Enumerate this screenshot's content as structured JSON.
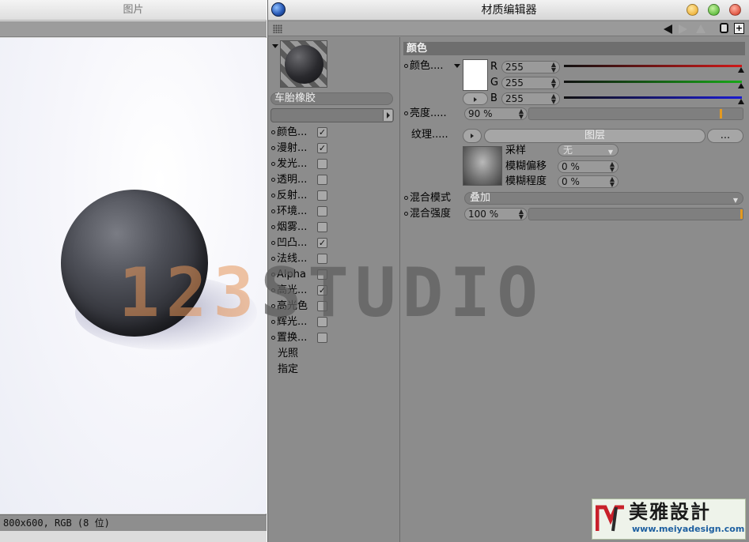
{
  "viewer": {
    "title": "图片",
    "status": "800x600, RGB (8 位)"
  },
  "editor": {
    "title": "材质编辑器",
    "material_name": "车胎橡胶",
    "channels": [
      {
        "label": "颜色...",
        "checked": true
      },
      {
        "label": "漫射...",
        "checked": true
      },
      {
        "label": "发光...",
        "checked": false
      },
      {
        "label": "透明...",
        "checked": false
      },
      {
        "label": "反射...",
        "checked": false
      },
      {
        "label": "环境...",
        "checked": false
      },
      {
        "label": "烟雾...",
        "checked": false
      },
      {
        "label": "凹凸...",
        "checked": true
      },
      {
        "label": "法线...",
        "checked": false
      },
      {
        "label": "Alpha",
        "checked": false
      },
      {
        "label": "高光...",
        "checked": true
      },
      {
        "label": "高光色",
        "checked": false
      },
      {
        "label": "辉光...",
        "checked": false
      },
      {
        "label": "置换...",
        "checked": false
      }
    ],
    "extra_items": [
      "光照",
      "指定"
    ],
    "section_title": "颜色",
    "color": {
      "label": "颜色....",
      "swatch": "#ffffff",
      "r_label": "R",
      "r_value": "255",
      "g_label": "G",
      "g_value": "255",
      "b_label": "B",
      "b_value": "255",
      "r_color": "#d01818",
      "g_color": "#18a818",
      "b_color": "#1a1ad0"
    },
    "brightness": {
      "label": "亮度.....",
      "value": "90 %",
      "level_percent": 90
    },
    "texture": {
      "label": "纹理.....",
      "layer_button": "图层",
      "more_button": "...",
      "sampling_label": "采样",
      "sampling_value": "无",
      "blur_offset_label": "模糊偏移",
      "blur_offset_value": "0 %",
      "blur_scale_label": "模糊程度",
      "blur_scale_value": "0 %"
    },
    "mix_mode": {
      "label": "混合模式",
      "value": "叠加"
    },
    "mix_strength": {
      "label": "混合强度",
      "value": "100 %",
      "level_percent": 100
    }
  },
  "watermark": {
    "part_a": "123",
    "part_b": "STUDIO"
  },
  "logo": {
    "chinese": "美雅設計",
    "url": "www.meiyadesign.com"
  }
}
